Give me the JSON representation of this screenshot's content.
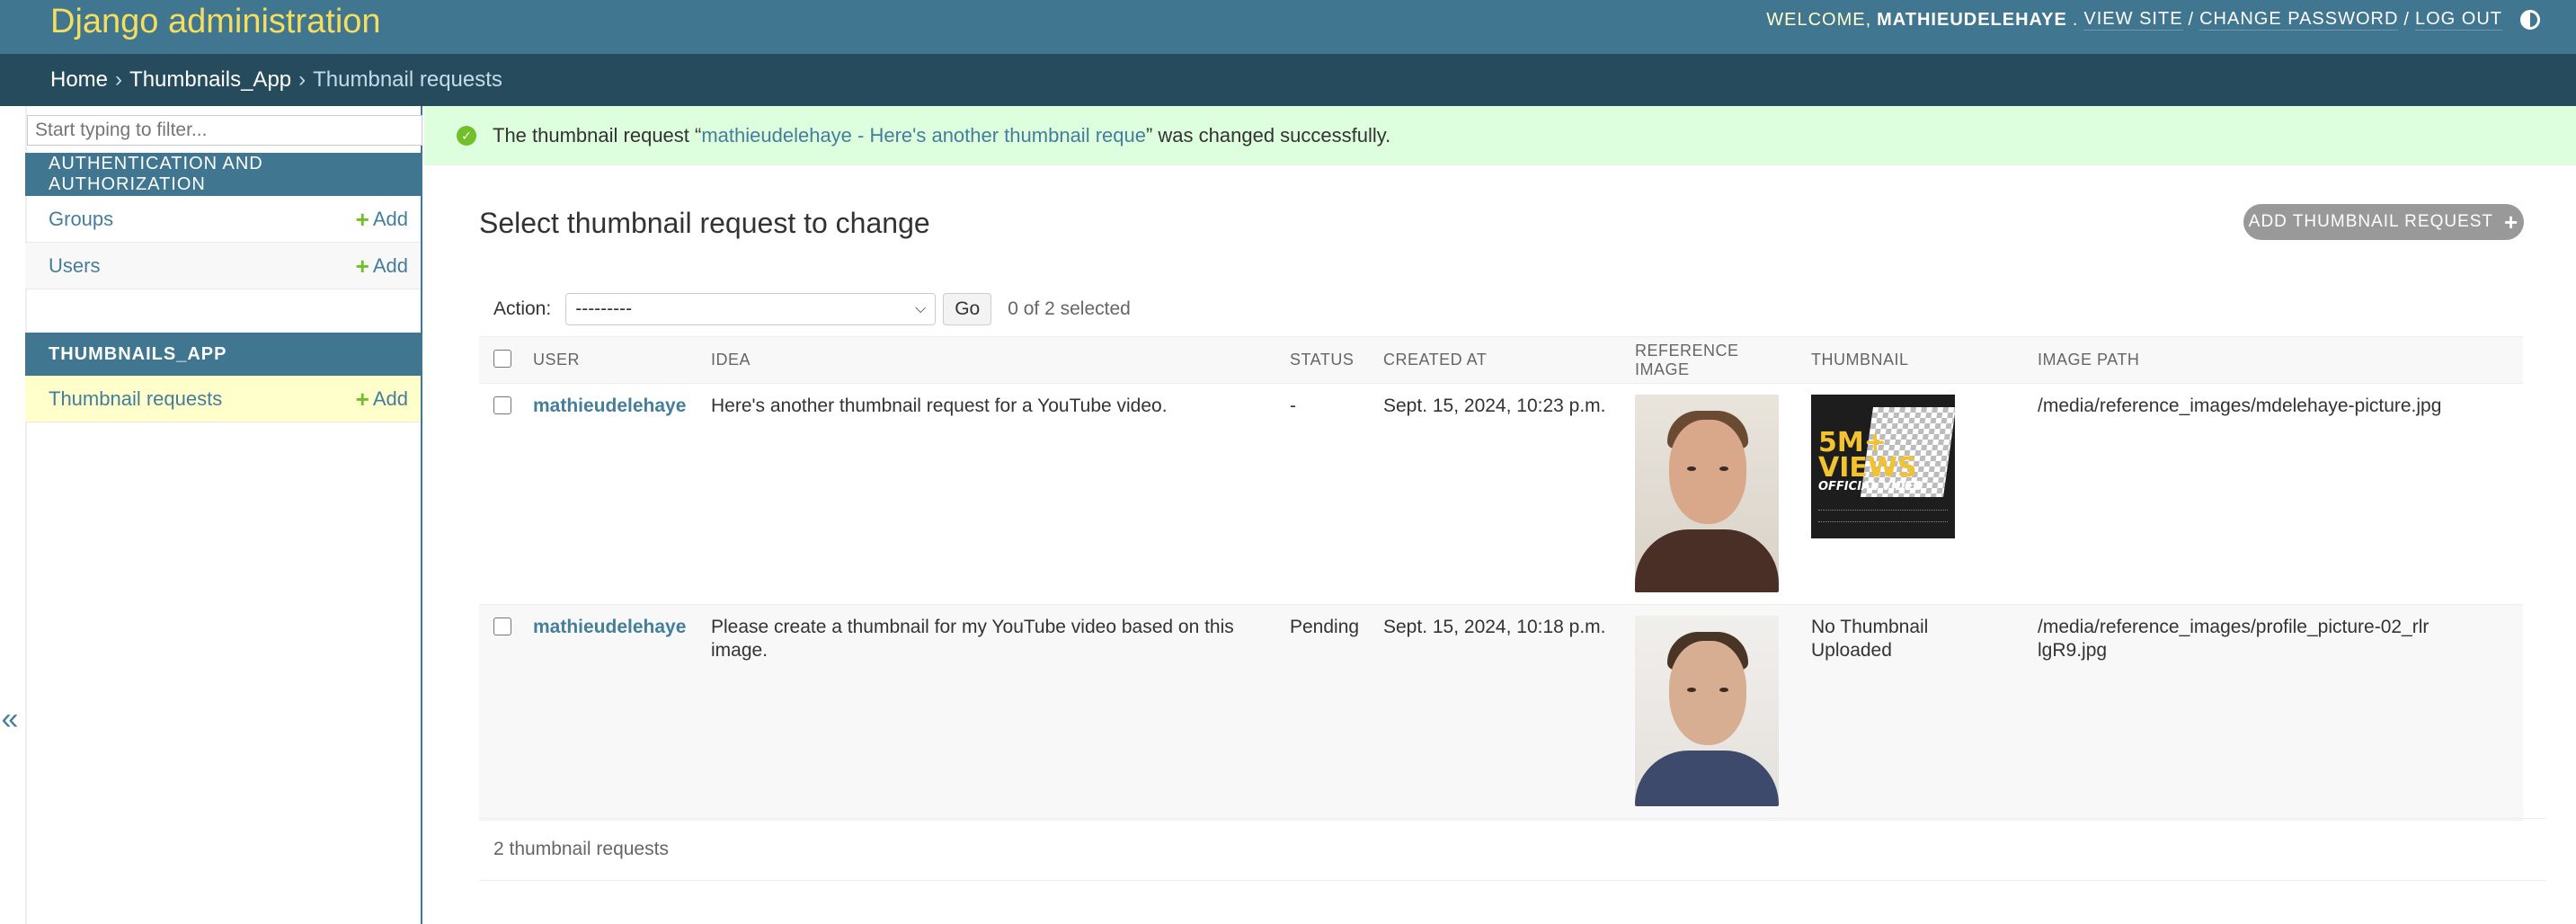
{
  "header": {
    "site_title": "Django administration",
    "welcome": "Welcome,",
    "username": "mathieudelehaye",
    "view_site": "View site",
    "change_password": "Change password",
    "log_out": "Log out",
    "separator": "/"
  },
  "breadcrumbs": {
    "home": "Home",
    "app": "Thumbnails_App",
    "current": "Thumbnail requests",
    "separator": "›"
  },
  "sidebar": {
    "filter_placeholder": "Start typing to filter...",
    "modules": [
      {
        "caption": "Authentication and Authorization",
        "items": [
          {
            "label": "Groups",
            "add": "Add"
          },
          {
            "label": "Users",
            "add": "Add"
          }
        ]
      },
      {
        "caption": "Thumbnails_App",
        "items": [
          {
            "label": "Thumbnail requests",
            "add": "Add"
          }
        ]
      }
    ],
    "collapse_label": "«"
  },
  "message": {
    "before": "The thumbnail request “",
    "link": "mathieudelehaye - Here's another thumbnail reque",
    "after": "” was changed successfully."
  },
  "content": {
    "title": "Select thumbnail request to change",
    "add_button": "Add thumbnail request",
    "action_label": "Action:",
    "action_selected": "---------",
    "go_label": "Go",
    "counter": "0 of 2 selected"
  },
  "table": {
    "columns": [
      "User",
      "Idea",
      "Status",
      "Created at",
      "Reference image",
      "Thumbnail",
      "Image path"
    ],
    "rows": [
      {
        "user": "mathieudelehaye",
        "idea": "Here's another thumbnail request for a YouTube video.",
        "status": "-",
        "created_at": "Sept. 15, 2024, 10:23 p.m.",
        "thumbnail_text": "",
        "thumbnail_big": "5M+ VIEWS",
        "thumbnail_small": "OFFICIAL VIDEO",
        "image_path": "/media/reference_images/mdelehaye-picture.jpg"
      },
      {
        "user": "mathieudelehaye",
        "idea": "Please create a thumbnail for my YouTube video based on this image.",
        "status": "Pending",
        "created_at": "Sept. 15, 2024, 10:18 p.m.",
        "thumbnail_text": "No Thumbnail Uploaded",
        "image_path": "/media/reference_images/profile_picture-02_rlrlgR9.jpg"
      }
    ]
  },
  "paginator": "2 thumbnail requests",
  "colors": {
    "header_bg": "#417690",
    "breadcrumb_bg": "#264b5d",
    "site_title": "#f5dd5d",
    "link": "#447e9b",
    "add_green": "#70bf2b",
    "success_bg": "#ddffdd",
    "current_row": "#ffffcc"
  }
}
